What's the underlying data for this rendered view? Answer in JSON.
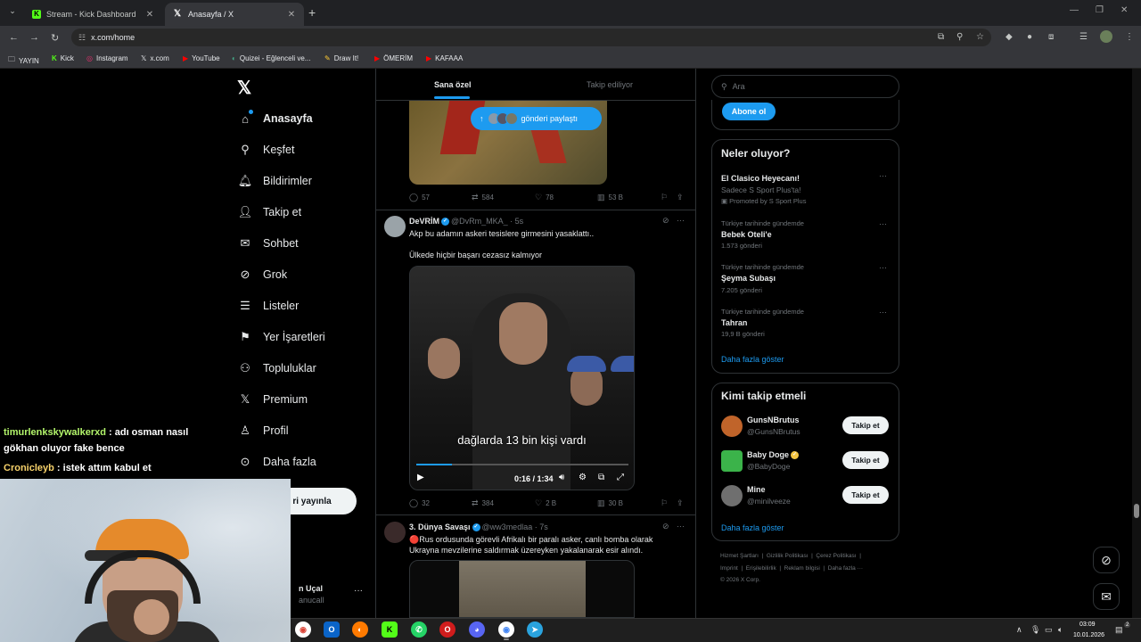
{
  "browser": {
    "tabs": [
      {
        "label": "Stream - Kick Dashboard",
        "favicon": "kick-icon"
      },
      {
        "label": "Anasayfa / X",
        "favicon": "x-icon"
      }
    ],
    "url": "x.com/home",
    "bookmarks": [
      "YAYIN",
      "Kick",
      "Instagram",
      "x.com",
      "YouTube",
      "Quizei - Eğlenceli ve...",
      "Draw It!",
      "ÖMERİM",
      "KAFAAA"
    ]
  },
  "nav": {
    "items": [
      "Anasayfa",
      "Keşfet",
      "Bildirimler",
      "Takip et",
      "Sohbet",
      "Grok",
      "Listeler",
      "Yer İşaretleri",
      "Topluluklar",
      "Premium",
      "Profil",
      "Daha fazla"
    ],
    "post_label": "ri yayınla",
    "account_name": "n Uçal",
    "account_handle": "anucall"
  },
  "feed": {
    "tabs": [
      "Sana özel",
      "Takip ediliyor"
    ],
    "shared_pill": "gönderi paylaştı",
    "post1_stats": {
      "replies": "57",
      "reposts": "584",
      "likes": "78",
      "views": "53 B"
    },
    "post2": {
      "name": "DeVRİM",
      "handle": "@DvRm_MKA_ · 5s",
      "text1": "Akp bu adamın askeri tesislere girmesini yasaklattı..",
      "text2": "Ülkede hiçbir başarı cezasız kalmıyor",
      "video_subtitle": "dağlarda 13 bin kişi vardı",
      "video_time": "0:16 / 1:34",
      "video_progress": 0.17,
      "stats": {
        "replies": "32",
        "reposts": "384",
        "likes": "2 B",
        "views": "30 B"
      }
    },
    "post3": {
      "name": "3. Dünya Savaşı",
      "handle": "@ww3medlaa · 7s",
      "text": "🔴Rus ordusunda görevli Afrikalı bir paralı asker, canlı bomba olarak Ukrayna mevzilerine saldırmak üzereyken yakalanarak esir alındı."
    }
  },
  "right": {
    "search_placeholder": "Ara",
    "subscribe_label": "Abone ol",
    "trends_title": "Neler oluyor?",
    "promo": {
      "name": "El Clasico Heyecanı!",
      "desc": "Sadece S Sport Plus'ta!",
      "promoted": "Promoted by S Sport Plus"
    },
    "trends": [
      {
        "context": "Türkiye tarihinde gündemde",
        "name": "Bebek Oteli'e",
        "count": "1.573 gönderi"
      },
      {
        "context": "Türkiye tarihinde gündemde",
        "name": "Şeyma Subaşı",
        "count": "7.205 gönderi"
      },
      {
        "context": "Türkiye tarihinde gündemde",
        "name": "Tahran",
        "count": "19,9 B gönderi"
      }
    ],
    "show_more": "Daha fazla göster",
    "wtf_title": "Kimi takip etmeli",
    "who_to_follow": [
      {
        "name": "GunsNBrutus",
        "handle": "@GunsNBrutus",
        "button": "Takip et"
      },
      {
        "name": "Baby Doge",
        "handle": "@BabyDoge",
        "button": "Takip et"
      },
      {
        "name": "Mine",
        "handle": "@minilveeze",
        "button": "Takip et"
      }
    ],
    "footer_links": [
      "Hizmet Şartları",
      "Gizlilik Politikası",
      "Çerez Politikası",
      "Imprint",
      "Erişilebilirlik",
      "Reklam bilgisi",
      "Daha fazla ···"
    ],
    "copyright": "© 2026 X Corp."
  },
  "chat": [
    {
      "user": "timurlenkskywalkerxd",
      "msg": ": adı osman nasıl"
    },
    {
      "user": "",
      "msg": "gökhan oluyor fake bence"
    },
    {
      "user": "Cronicleyb",
      "msg": ": istek attım kabul et"
    }
  ],
  "taskbar": {
    "time": "03:09",
    "date": "10.01.2026",
    "notif_count": "2"
  },
  "colors": {
    "accent": "#1d9bf0",
    "bg": "#000000",
    "border": "#2f3336"
  }
}
